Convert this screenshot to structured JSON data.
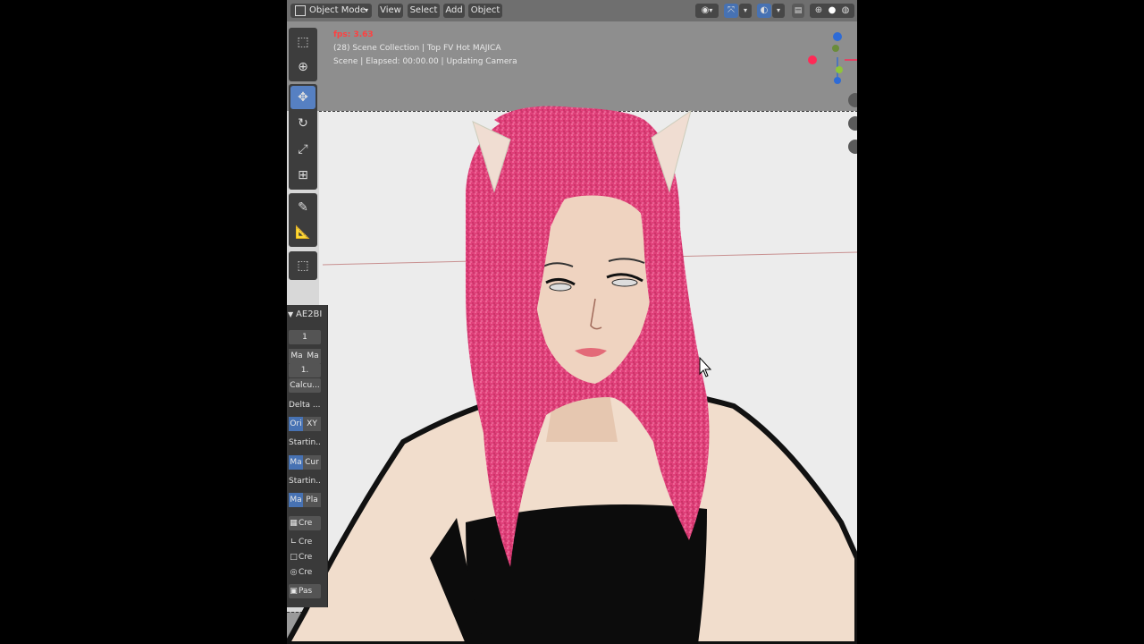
{
  "header": {
    "mode_label": "Object Mode",
    "mode_icon": "object-mode-icon",
    "menus": [
      "View",
      "Select",
      "Add",
      "Object"
    ]
  },
  "overlay": {
    "fps": "fps: 3.63",
    "line1": "(28) Scene Collection | Top FV Hot MAJICA",
    "line2": "Scene | Elapsed: 00:00.00 | Updating Camera"
  },
  "panel": {
    "title": "AE2BI",
    "field_1": "1",
    "seg_ma_a": "Ma",
    "seg_ma_b": "Ma",
    "field_1b": "1.",
    "calc_button": "Calcu...",
    "delta_label": "Delta ...",
    "seg_ori": "Ori",
    "seg_xy": "XY",
    "starting_label_1": "Startin...",
    "seg_ma_c": "Ma",
    "seg_cur": "Cur",
    "starting_label_2": "Startin...",
    "seg_ma_d": "Ma",
    "seg_pla": "Pla",
    "create_1": "Cre",
    "create_2": "Cre",
    "create_3": "Cre",
    "create_4": "Cre",
    "paste": "Pas"
  },
  "colors": {
    "accent": "#4772b3",
    "header_bg": "#6f6f6f",
    "panel_bg": "#3a3a3a",
    "hair": "#e0407a"
  }
}
